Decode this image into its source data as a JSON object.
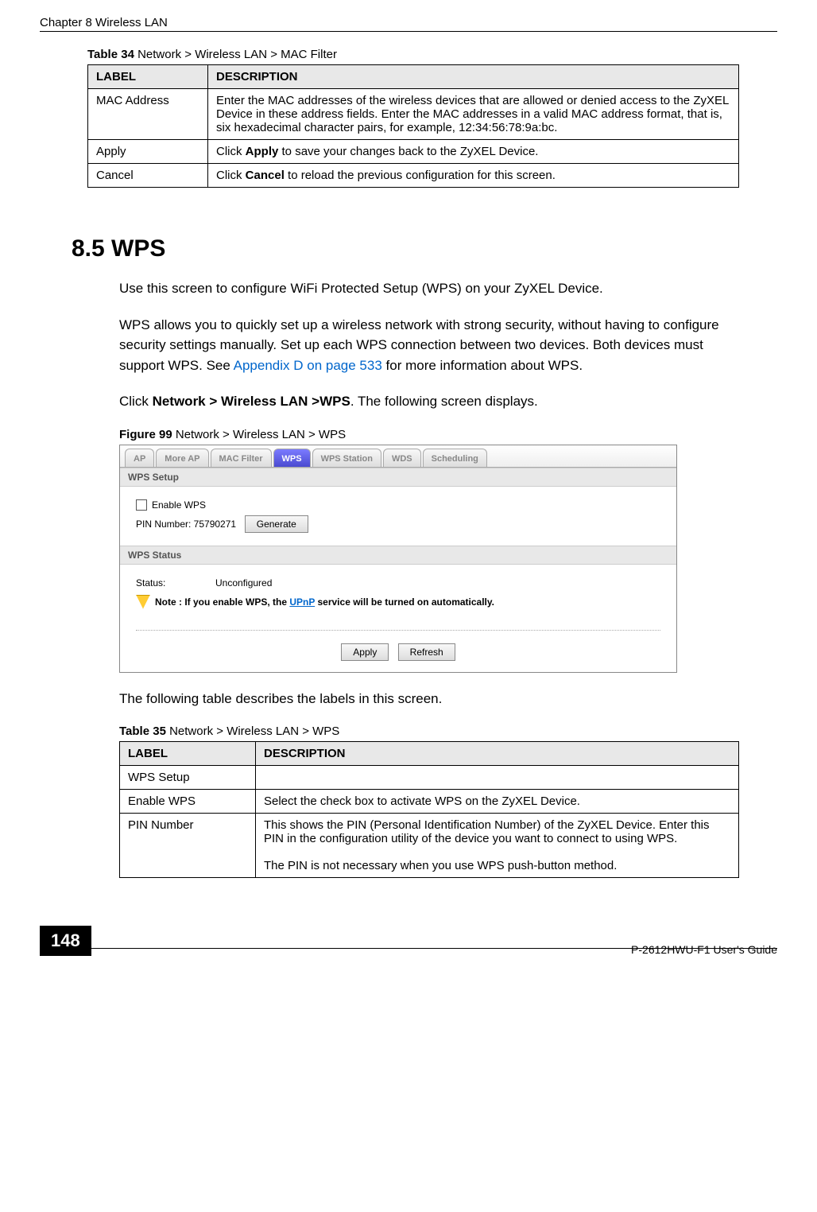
{
  "header": {
    "chapter": "Chapter 8 Wireless LAN"
  },
  "table34": {
    "caption_bold": "Table 34",
    "caption_rest": "   Network > Wireless LAN > MAC Filter",
    "headers": [
      "LABEL",
      "DESCRIPTION"
    ],
    "rows": [
      {
        "label": "MAC Address",
        "desc": "Enter the MAC addresses of the wireless devices that are allowed or denied access to the ZyXEL Device in these address fields. Enter the MAC addresses in a valid MAC address format, that is, six hexadecimal character pairs, for example, 12:34:56:78:9a:bc."
      },
      {
        "label": "Apply",
        "desc_pre": "Click ",
        "desc_bold": "Apply",
        "desc_post": " to save your changes back to the ZyXEL Device."
      },
      {
        "label": "Cancel",
        "desc_pre": "Click ",
        "desc_bold": "Cancel",
        "desc_post": " to reload the previous configuration for this screen."
      }
    ]
  },
  "section": {
    "heading": "8.5  WPS",
    "p1": "Use this screen to configure WiFi Protected Setup (WPS) on your ZyXEL Device.",
    "p2_pre": "WPS allows you to quickly set up a wireless network with strong security, without having to configure security settings manually. Set up each WPS connection between two devices. Both devices must support WPS. See ",
    "p2_link": "Appendix D on page 533",
    "p2_post": " for more information about WPS.",
    "p3_pre": "Click ",
    "p3_bold": "Network > Wireless LAN >WPS",
    "p3_post": ". The following screen displays.",
    "fig_caption_bold": "Figure 99",
    "fig_caption_rest": "   Network > Wireless LAN > WPS",
    "post_fig": "The following table describes the labels in this screen."
  },
  "screenshot": {
    "tabs": [
      "AP",
      "More AP",
      "MAC Filter",
      "WPS",
      "WPS Station",
      "WDS",
      "Scheduling"
    ],
    "active_tab_index": 3,
    "wps_setup_title": "WPS Setup",
    "enable_wps_label": "Enable WPS",
    "pin_label": "PIN Number: 75790271",
    "generate_btn": "Generate",
    "wps_status_title": "WPS Status",
    "status_label": "Status:",
    "status_value": "Unconfigured",
    "note_prefix": "Note : If you enable WPS, the ",
    "note_link": "UPnP",
    "note_suffix": " service will be turned on automatically.",
    "apply_btn": "Apply",
    "refresh_btn": "Refresh"
  },
  "table35": {
    "caption_bold": "Table 35",
    "caption_rest": "   Network > Wireless LAN > WPS",
    "headers": [
      "LABEL",
      "DESCRIPTION"
    ],
    "rows": [
      {
        "label": "WPS Setup",
        "desc": ""
      },
      {
        "label": "Enable WPS",
        "desc": "Select the check box to activate WPS on the ZyXEL Device."
      },
      {
        "label": "PIN Number",
        "desc": "This shows the PIN (Personal Identification Number) of the ZyXEL Device. Enter this PIN in the configuration utility of the device you want to connect to using WPS.\n\nThe PIN is not necessary when you use WPS push-button method."
      }
    ]
  },
  "footer": {
    "page_number": "148",
    "guide": "P-2612HWU-F1 User's Guide"
  }
}
